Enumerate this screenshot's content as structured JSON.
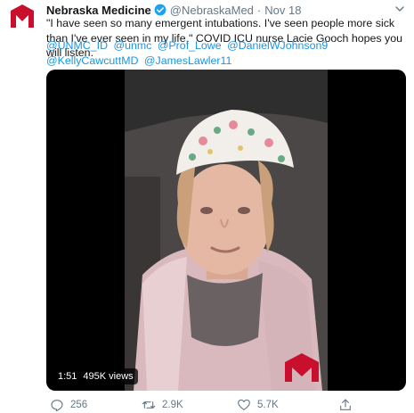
{
  "tweet": {
    "display_name": "Nebraska Medicine",
    "handle": "@NebraskaMed",
    "separator": "·",
    "date": "Nov 18",
    "text": "\"I have seen so many emergent intubations. I've seen people more sick than I've ever seen in my life.\" COVID ICU nurse Lacie Gooch hopes you will listen.",
    "mentions": [
      "@UNMC_ID",
      "@unmc",
      "@Prof_Lowe",
      "@DanielWJohnson9",
      "@KellyCawcuttMD",
      "@JamesLawler11"
    ],
    "video": {
      "duration": "1:51",
      "views": "495K views"
    },
    "actions": {
      "replies": "256",
      "retweets": "2.9K",
      "likes": "5.7K"
    }
  },
  "colors": {
    "brand_red": "#c8102e",
    "link_blue": "#1b95e0",
    "verified_blue": "#1da1f2",
    "muted_gray": "#657786"
  },
  "icons": {
    "avatar": "nebraska-medicine-logo",
    "verified": "verified-badge-icon",
    "menu": "chevron-down-icon",
    "reply": "reply-icon",
    "retweet": "retweet-icon",
    "like": "heart-icon",
    "share": "share-icon"
  }
}
